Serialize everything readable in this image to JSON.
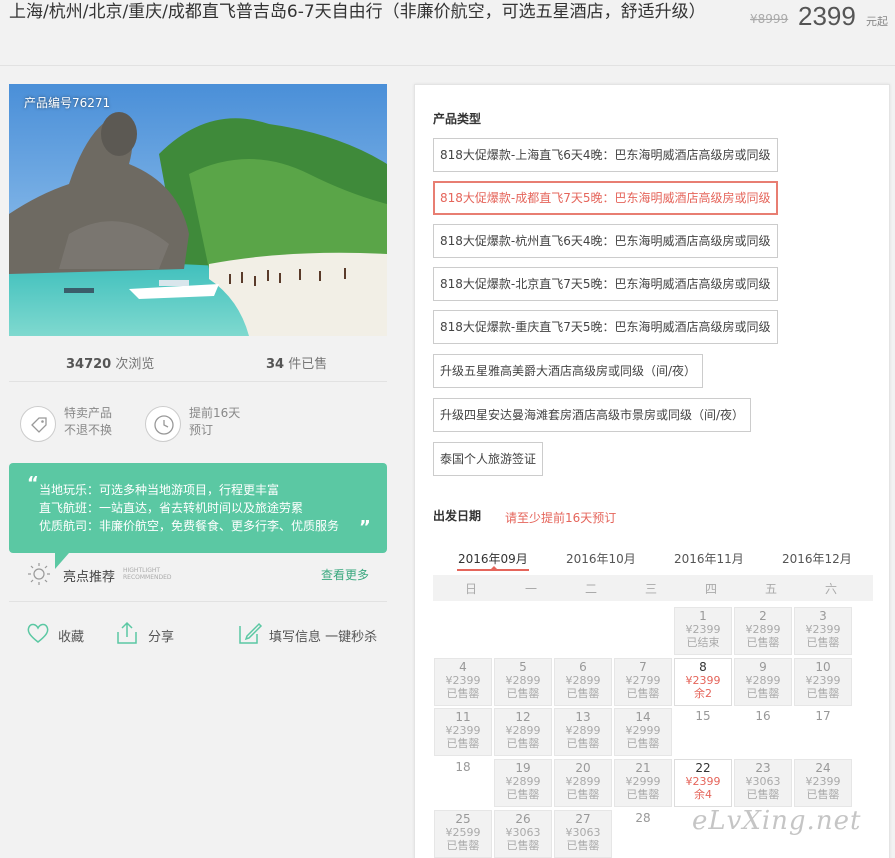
{
  "header": {
    "title": "上海/杭州/北京/重庆/成都直飞普吉岛6-7天自由行（非廉价航空，可选五星酒店，舒适升级）",
    "old_price": "¥8999",
    "price": "2399",
    "price_unit": "元起"
  },
  "photo": {
    "product_code": "产品编号76271"
  },
  "stats": {
    "views_count": "34720",
    "views_label": "次浏览",
    "sold_count": "34",
    "sold_label": "件已售"
  },
  "features": [
    {
      "icon": "tag-icon",
      "line1": "特卖产品",
      "line2": "不退不换"
    },
    {
      "icon": "clock-icon",
      "line1": "提前16天",
      "line2": "预订"
    }
  ],
  "highlights": [
    "当地玩乐：可选多种当地游项目，行程更丰富",
    "直飞航班：一站直达，省去转机时间以及旅途劳累",
    "优质航司：非廉价航空，免费餐食、更多行李、优质服务"
  ],
  "recommend": {
    "title": "亮点推荐",
    "subtitle_en1": "HIGHTLIGHT",
    "subtitle_en2": "RECOMMENDED",
    "more": "查看更多"
  },
  "actions": {
    "favorite": "收藏",
    "share": "分享",
    "fill_info": "填写信息 一键秒杀"
  },
  "product_types": {
    "label": "产品类型",
    "options": [
      "818大促爆款-上海直飞6天4晚：巴东海明威酒店高级房或同级",
      "818大促爆款-成都直飞7天5晚：巴东海明威酒店高级房或同级",
      "818大促爆款-杭州直飞6天4晚：巴东海明威酒店高级房或同级",
      "818大促爆款-北京直飞7天5晚：巴东海明威酒店高级房或同级",
      "818大促爆款-重庆直飞7天5晚：巴东海明威酒店高级房或同级",
      "升级五星雅高美爵大酒店高级房或同级（间/夜）",
      "升级四星安达曼海滩套房酒店高级市景房或同级（间/夜）",
      "泰国个人旅游签证"
    ],
    "selected_index": 1
  },
  "departure": {
    "label": "出发日期",
    "hint": "请至少提前16天预订",
    "months": [
      "2016年09月",
      "2016年10月",
      "2016年11月",
      "2016年12月"
    ],
    "active_month": "2016年09月",
    "weekdays": [
      "日",
      "一",
      "二",
      "三",
      "四",
      "五",
      "六"
    ],
    "days": [
      {
        "day": "1",
        "price": "¥2399",
        "status": "已结束",
        "kind": "boxed"
      },
      {
        "day": "2",
        "price": "¥2899",
        "status": "已售罄",
        "kind": "boxed"
      },
      {
        "day": "3",
        "price": "¥2399",
        "status": "已售罄",
        "kind": "boxed"
      },
      {
        "day": "4",
        "price": "¥2399",
        "status": "已售罄",
        "kind": "boxed"
      },
      {
        "day": "5",
        "price": "¥2899",
        "status": "已售罄",
        "kind": "boxed"
      },
      {
        "day": "6",
        "price": "¥2899",
        "status": "已售罄",
        "kind": "boxed"
      },
      {
        "day": "7",
        "price": "¥2799",
        "status": "已售罄",
        "kind": "boxed"
      },
      {
        "day": "8",
        "price": "¥2399",
        "status": "余2",
        "kind": "avail"
      },
      {
        "day": "9",
        "price": "¥2899",
        "status": "已售罄",
        "kind": "boxed"
      },
      {
        "day": "10",
        "price": "¥2399",
        "status": "已售罄",
        "kind": "boxed"
      },
      {
        "day": "11",
        "price": "¥2399",
        "status": "已售罄",
        "kind": "boxed"
      },
      {
        "day": "12",
        "price": "¥2899",
        "status": "已售罄",
        "kind": "boxed"
      },
      {
        "day": "13",
        "price": "¥2899",
        "status": "已售罄",
        "kind": "boxed"
      },
      {
        "day": "14",
        "price": "¥2999",
        "status": "已售罄",
        "kind": "boxed"
      },
      {
        "day": "15",
        "price": "",
        "status": "",
        "kind": "plain"
      },
      {
        "day": "16",
        "price": "",
        "status": "",
        "kind": "plain"
      },
      {
        "day": "17",
        "price": "",
        "status": "",
        "kind": "plain"
      },
      {
        "day": "18",
        "price": "",
        "status": "",
        "kind": "plain"
      },
      {
        "day": "19",
        "price": "¥2899",
        "status": "已售罄",
        "kind": "boxed"
      },
      {
        "day": "20",
        "price": "¥2899",
        "status": "已售罄",
        "kind": "boxed"
      },
      {
        "day": "21",
        "price": "¥2999",
        "status": "已售罄",
        "kind": "boxed"
      },
      {
        "day": "22",
        "price": "¥2399",
        "status": "余4",
        "kind": "avail"
      },
      {
        "day": "23",
        "price": "¥3063",
        "status": "已售罄",
        "kind": "boxed"
      },
      {
        "day": "24",
        "price": "¥2399",
        "status": "已售罄",
        "kind": "boxed"
      },
      {
        "day": "25",
        "price": "¥2599",
        "status": "已售罄",
        "kind": "boxed"
      },
      {
        "day": "26",
        "price": "¥3063",
        "status": "已售罄",
        "kind": "boxed"
      },
      {
        "day": "27",
        "price": "¥3063",
        "status": "已售罄",
        "kind": "boxed"
      },
      {
        "day": "28",
        "price": "",
        "status": "",
        "kind": "plain"
      }
    ],
    "first_weekday": 4
  },
  "watermark": "eLvXing.net",
  "colors": {
    "accent": "#e5655b",
    "green": "#5bc8a3"
  }
}
